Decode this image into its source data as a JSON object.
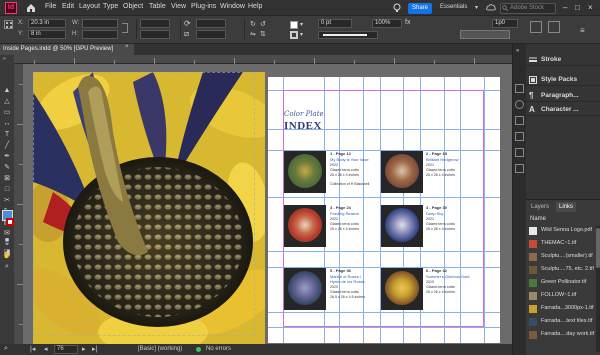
{
  "app": {
    "logo_text": "Id"
  },
  "menu": [
    "File",
    "Edit",
    "Layout",
    "Type",
    "Object",
    "Table",
    "View",
    "Plug-ins",
    "Window",
    "Help"
  ],
  "topbar": {
    "share_label": "Share",
    "workspace": "Essentials",
    "search_placeholder": "Adobe Stock"
  },
  "control": {
    "x_label": "X:",
    "x_value": "20.3 in",
    "y_label": "Y:",
    "y_value": "8 in",
    "w_label": "W:",
    "h_label": "H:",
    "stroke_weight": "0 pt",
    "percent": "100%",
    "scale_value": "1p0"
  },
  "document_tab": {
    "title": "Inside Pages.indd @ 50% [GPU Preview]",
    "close": "×"
  },
  "page": {
    "subtitle": "Color Plate",
    "title": "INDEX",
    "plates": [
      {
        "num": "1 - Page 12",
        "title": "My Body is Your Vase",
        "year": "2022",
        "medium": "Glazed terra cotta",
        "size": "26 x 26 x 4 inches",
        "extra": "Collection of H Blackwell",
        "c1": "#4a6b3a",
        "c2": "#c9a84a"
      },
      {
        "num": "2 - Page 18",
        "title": "Brilliant Hedgerow",
        "year": "2021",
        "medium": "Glazed terra cotta",
        "size": "26 x 26 x 4 inches",
        "extra": "",
        "c1": "#7a4a3a",
        "c2": "#d8c8a8"
      },
      {
        "num": "3 - Page 24",
        "title": "Feeding Season",
        "year": "2022",
        "medium": "Glazed terra cotta",
        "size": "26 x 26 x 4 inches",
        "extra": "",
        "c1": "#b83a2a",
        "c2": "#e8d8c0"
      },
      {
        "num": "4 - Page 30",
        "title": "Deep Sky",
        "year": "2021",
        "medium": "Glazed terra cotta",
        "size": "26 x 26 x 4 inches",
        "extra": "",
        "c1": "#3a4a8a",
        "c2": "#e0e0e8"
      },
      {
        "num": "5 - Page 36",
        "title": "Mantle of Roses /",
        "title2": "Hymn de los Rosas",
        "year": "2020",
        "medium": "Glazed terra cotta",
        "size": "26.5 x 26 x 4.5 inches",
        "extra": "",
        "c1": "#3a4a6a",
        "c2": "#9aa0c8"
      },
      {
        "num": "6 - Page 42",
        "title": "Summer's Glorious Gold",
        "year": "2019",
        "medium": "Glazed terra cotta",
        "size": "26 x 26 x 4 inches",
        "extra": "",
        "c1": "#c8a030",
        "c2": "#5a3a2a"
      }
    ]
  },
  "status": {
    "page_number": "76",
    "style": "[Basic] (working)",
    "preflight": "No errors",
    "zoom_icon": "magnifier-icon"
  },
  "panels": [
    {
      "label": "Stroke",
      "icon": "stroke-icon"
    },
    {
      "label": "Style Packs",
      "icon": "style-packs-icon"
    },
    {
      "label": "Paragraph...",
      "icon": "paragraph-icon"
    },
    {
      "label": "Character ...",
      "icon": "character-icon"
    }
  ],
  "links_panel": {
    "tab_layers": "Layers",
    "tab_links": "Links",
    "column": "Name",
    "items": [
      {
        "name": "Wild Senna Logo.pdf",
        "color": "#e8e8e8"
      },
      {
        "name": "THEMAC~1.tif",
        "color": "#c84a3a"
      },
      {
        "name": "Sculptu....(smaller).tif",
        "color": "#8a6a4a"
      },
      {
        "name": "Sculptu....75, etc. 2.tif",
        "color": "#6a5a3a"
      },
      {
        "name": "Green Pollinator.tif",
        "color": "#4a7a3a"
      },
      {
        "name": "FOLLOW~1.tif",
        "color": "#9a8a6a"
      },
      {
        "name": "Farrada...3000px-1.tif",
        "color": "#c8a030"
      },
      {
        "name": "Farrada....text tiles.tif",
        "color": "#3a4a6a"
      },
      {
        "name": "Farrada....day work.tif",
        "color": "#7a5a3a"
      }
    ]
  },
  "colors": {
    "accent": "#1473e6",
    "fill_swatch": "#4a90d9",
    "guide": "#8bb2e8",
    "title_blue": "#2e3c7a"
  }
}
